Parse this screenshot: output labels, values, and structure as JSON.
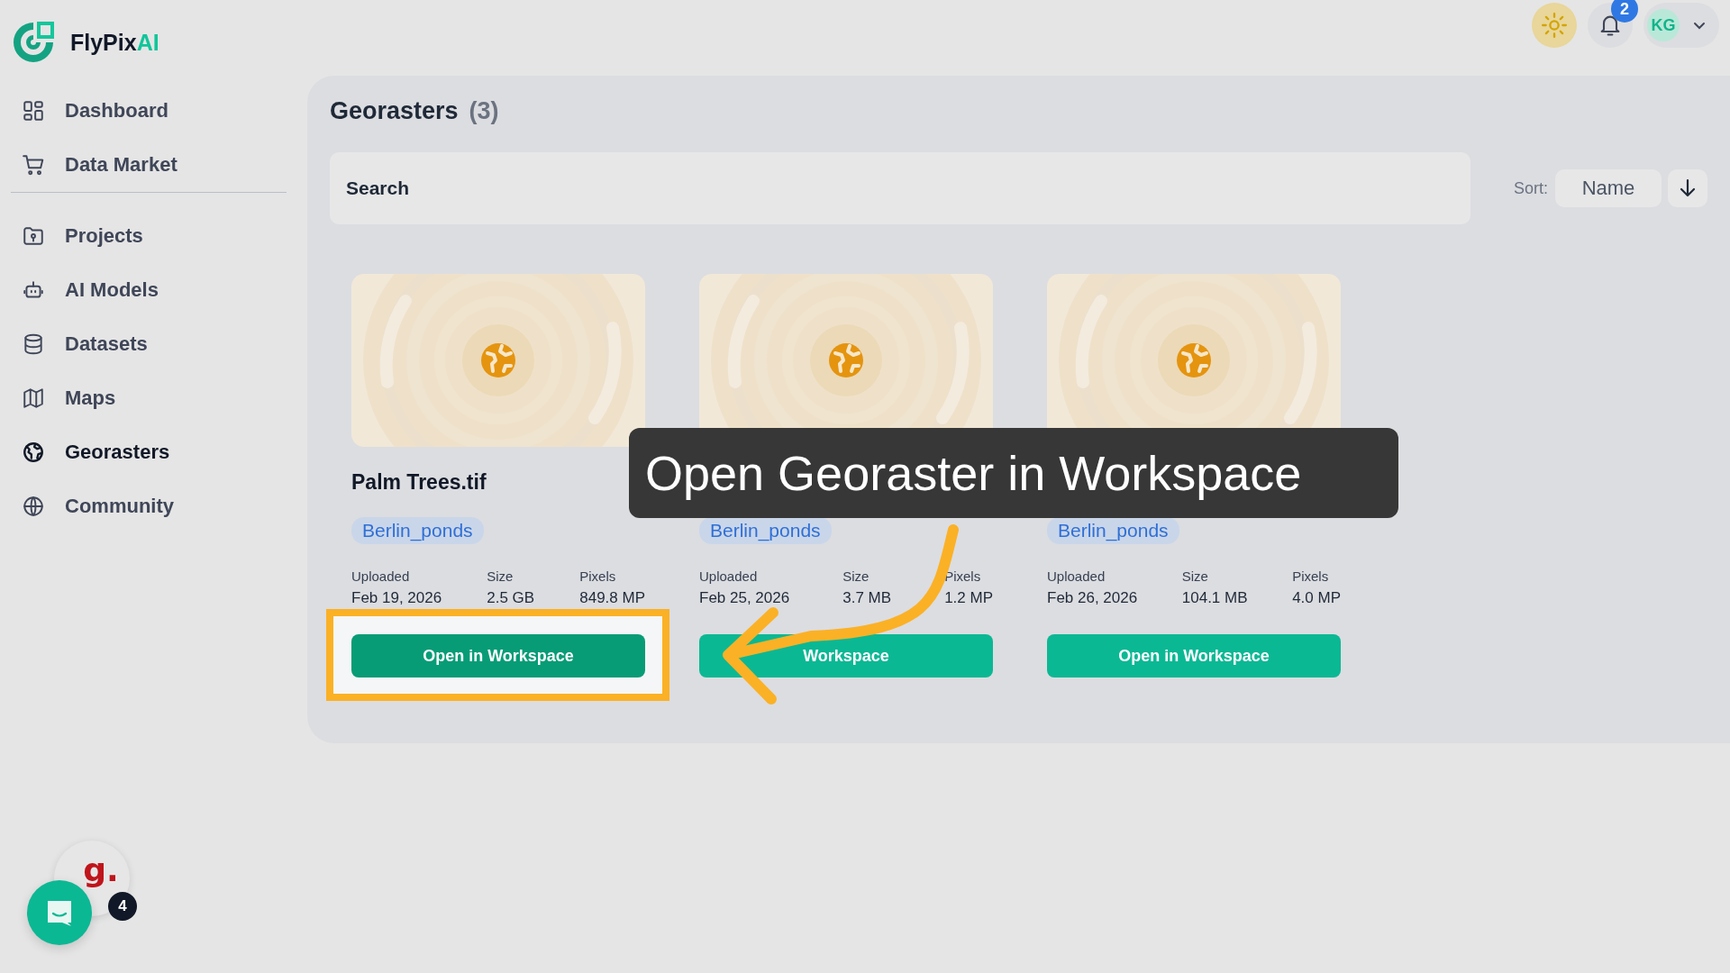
{
  "brand": {
    "name": "FlyPix",
    "accent": "AI"
  },
  "sidebar": {
    "sections": [
      {
        "items": [
          {
            "label": "Dashboard",
            "selected": false
          },
          {
            "label": "Data Market",
            "selected": false
          }
        ]
      },
      {
        "items": [
          {
            "label": "Projects",
            "selected": false
          },
          {
            "label": "AI Models",
            "selected": false
          },
          {
            "label": "Datasets",
            "selected": false
          },
          {
            "label": "Maps",
            "selected": false
          },
          {
            "label": "Georasters",
            "selected": true
          },
          {
            "label": "Community",
            "selected": false
          }
        ]
      }
    ]
  },
  "header": {
    "notifications": "2",
    "user_initials": "KG"
  },
  "page": {
    "title": "Georasters",
    "count": "(3)",
    "search": {
      "placeholder": "Search"
    },
    "sort": {
      "label": "Sort:",
      "value": "Name"
    }
  },
  "cards": [
    {
      "title": "Palm Trees.tif",
      "tag": "Berlin_ponds",
      "meta": [
        {
          "label": "Uploaded",
          "value": "Feb 19, 2026"
        },
        {
          "label": "Size",
          "value": "2.5 GB"
        },
        {
          "label": "Pixels",
          "value": "849.8 MP"
        }
      ],
      "button": "Open in Workspace",
      "highlighted": true
    },
    {
      "tag": "Berlin_ponds",
      "meta": [
        {
          "label": "Uploaded",
          "value": "Feb 25, 2026"
        },
        {
          "label": "Size",
          "value": "3.7 MB"
        },
        {
          "label": "Pixels",
          "value": "1.2 MP"
        }
      ],
      "button": "Workspace",
      "highlighted": false
    },
    {
      "tag": "Berlin_ponds",
      "meta": [
        {
          "label": "Uploaded",
          "value": "Feb 26, 2026"
        },
        {
          "label": "Size",
          "value": "104.1 MB"
        },
        {
          "label": "Pixels",
          "value": "4.0 MP"
        }
      ],
      "button": "Open in Workspace",
      "highlighted": false
    }
  ],
  "tooltip": "Open Georaster in Workspace",
  "widgets": {
    "badge": "4",
    "letter": "g."
  }
}
